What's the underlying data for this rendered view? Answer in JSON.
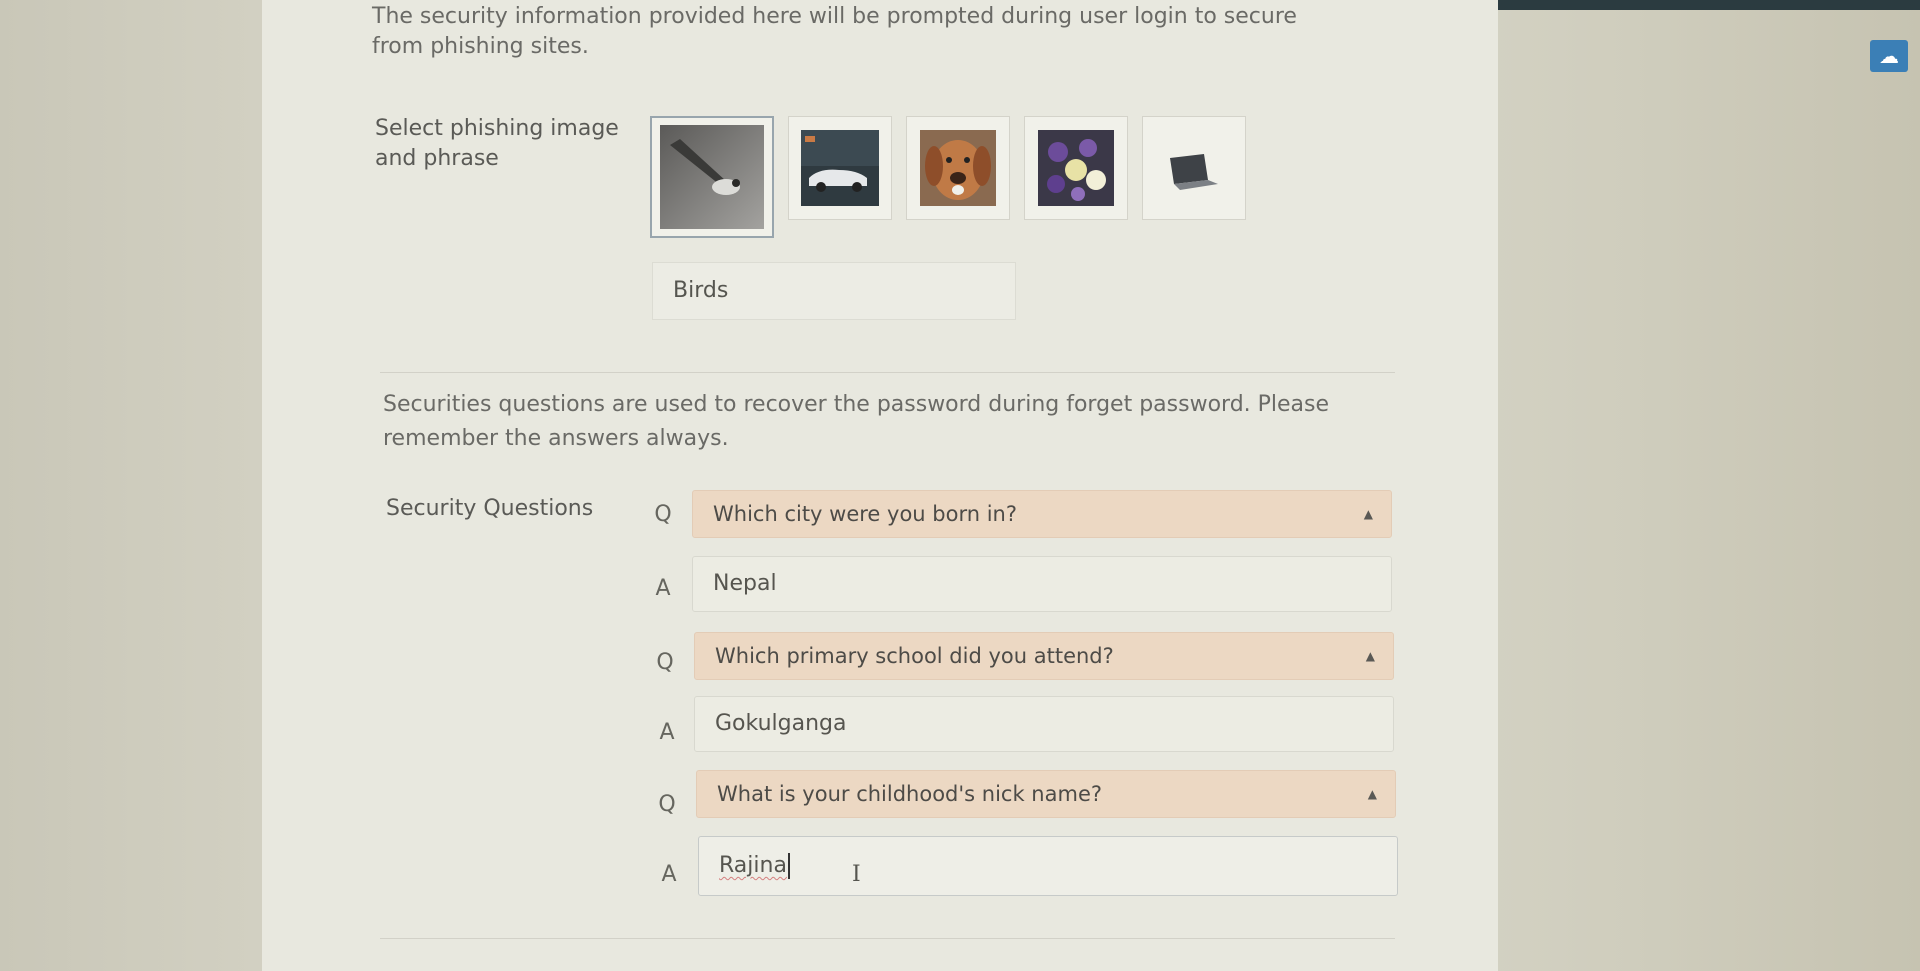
{
  "intro_text": "The security information provided here will be prompted during user login to secure from phishing sites.",
  "phishing": {
    "label": "Select phishing image and phrase",
    "images": [
      {
        "name": "birds",
        "selected": true
      },
      {
        "name": "car",
        "selected": false
      },
      {
        "name": "dog",
        "selected": false
      },
      {
        "name": "flowers",
        "selected": false
      },
      {
        "name": "laptop",
        "selected": false
      }
    ],
    "phrase": "Birds"
  },
  "security": {
    "note": "Securities questions are used to recover the password during forget password. Please remember the answers always.",
    "label": "Security Questions",
    "q_letter": "Q",
    "a_letter": "A",
    "pairs": [
      {
        "question": "Which city were you born in?",
        "answer": "Nepal"
      },
      {
        "question": "Which primary school did you attend?",
        "answer": "Gokulganga"
      },
      {
        "question": "What is your childhood's nick name?",
        "answer": "Rajina"
      }
    ]
  },
  "colors": {
    "select_bg": "#ecd8c3",
    "panel_bg": "#e8e8df",
    "badge": "#3b7fb6"
  },
  "icons": {
    "select_caret": "sort-caret-icon",
    "corner_badge": "cloud-icon",
    "text_cursor": "ibeam-cursor-icon"
  }
}
